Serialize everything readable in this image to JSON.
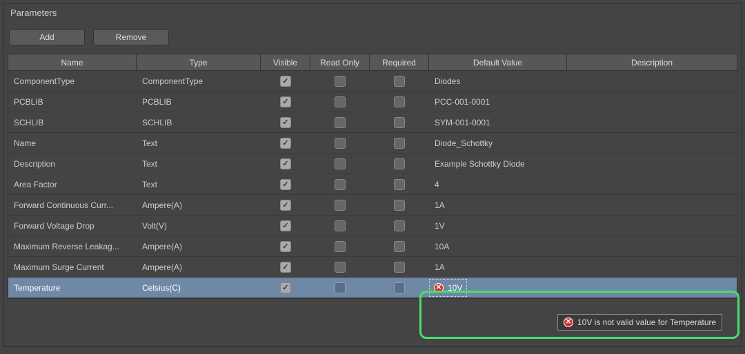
{
  "panel": {
    "title": "Parameters"
  },
  "toolbar": {
    "add": "Add",
    "remove": "Remove"
  },
  "headers": {
    "name": "Name",
    "type": "Type",
    "visible": "Visible",
    "readonly": "Read Only",
    "required": "Required",
    "default": "Default Value",
    "description": "Description"
  },
  "rows": [
    {
      "name": "ComponentType",
      "type": "ComponentType",
      "visible": true,
      "readonly": false,
      "required": false,
      "default": "Diodes",
      "description": ""
    },
    {
      "name": "PCBLIB",
      "type": "PCBLIB",
      "visible": true,
      "readonly": false,
      "required": false,
      "default": "PCC-001-0001",
      "description": ""
    },
    {
      "name": "SCHLIB",
      "type": "SCHLIB",
      "visible": true,
      "readonly": false,
      "required": false,
      "default": "SYM-001-0001",
      "description": ""
    },
    {
      "name": "Name",
      "type": "Text",
      "visible": true,
      "readonly": false,
      "required": false,
      "default": "Diode_Schottky",
      "description": ""
    },
    {
      "name": "Description",
      "type": "Text",
      "visible": true,
      "readonly": false,
      "required": false,
      "default": "Example Schottky Diode",
      "description": ""
    },
    {
      "name": "Area Factor",
      "type": "Text",
      "visible": true,
      "readonly": false,
      "required": false,
      "default": "4",
      "description": ""
    },
    {
      "name": "Forward Continuous Curr...",
      "type": "Ampere(A)",
      "visible": true,
      "readonly": false,
      "required": false,
      "default": "1A",
      "description": ""
    },
    {
      "name": "Forward Voltage Drop",
      "type": "Volt(V)",
      "visible": true,
      "readonly": false,
      "required": false,
      "default": "1V",
      "description": ""
    },
    {
      "name": "Maximum Reverse Leakag...",
      "type": "Ampere(A)",
      "visible": true,
      "readonly": false,
      "required": false,
      "default": "10A",
      "description": ""
    },
    {
      "name": "Maximum Surge Current",
      "type": "Ampere(A)",
      "visible": true,
      "readonly": false,
      "required": false,
      "default": "1A",
      "description": ""
    },
    {
      "name": "Temperature",
      "type": "Celsius(C)",
      "visible": true,
      "readonly": false,
      "required": false,
      "default": "10V",
      "description": "",
      "selected": true,
      "error": true
    }
  ],
  "error": {
    "value": "10V",
    "tooltip": "10V is not valid value for Temperature"
  }
}
